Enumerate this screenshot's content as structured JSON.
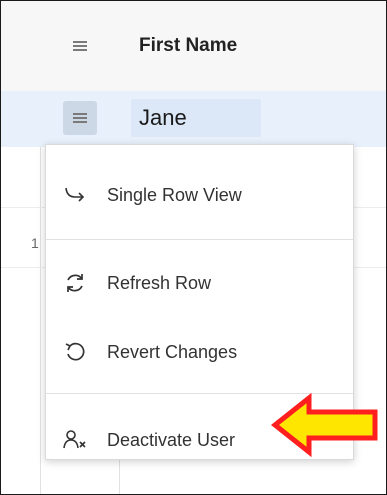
{
  "grid": {
    "header": {
      "column_title": "First Name"
    },
    "selected_row": {
      "first_name": "Jane"
    },
    "row_number": "1"
  },
  "context_menu": {
    "items": [
      {
        "label": "Single Row View",
        "icon": "redirect-arrow-icon"
      },
      {
        "label": "Refresh Row",
        "icon": "refresh-icon"
      },
      {
        "label": "Revert Changes",
        "icon": "undo-icon"
      },
      {
        "label": "Deactivate User",
        "icon": "user-remove-icon"
      }
    ]
  },
  "annotation": {
    "arrow_color": "#ff1f1f",
    "arrow_fill": "#ffe600",
    "direction": "left"
  },
  "colors": {
    "selected_row_bg": "#e8f0fb",
    "header_bg": "#f7f7f7"
  }
}
